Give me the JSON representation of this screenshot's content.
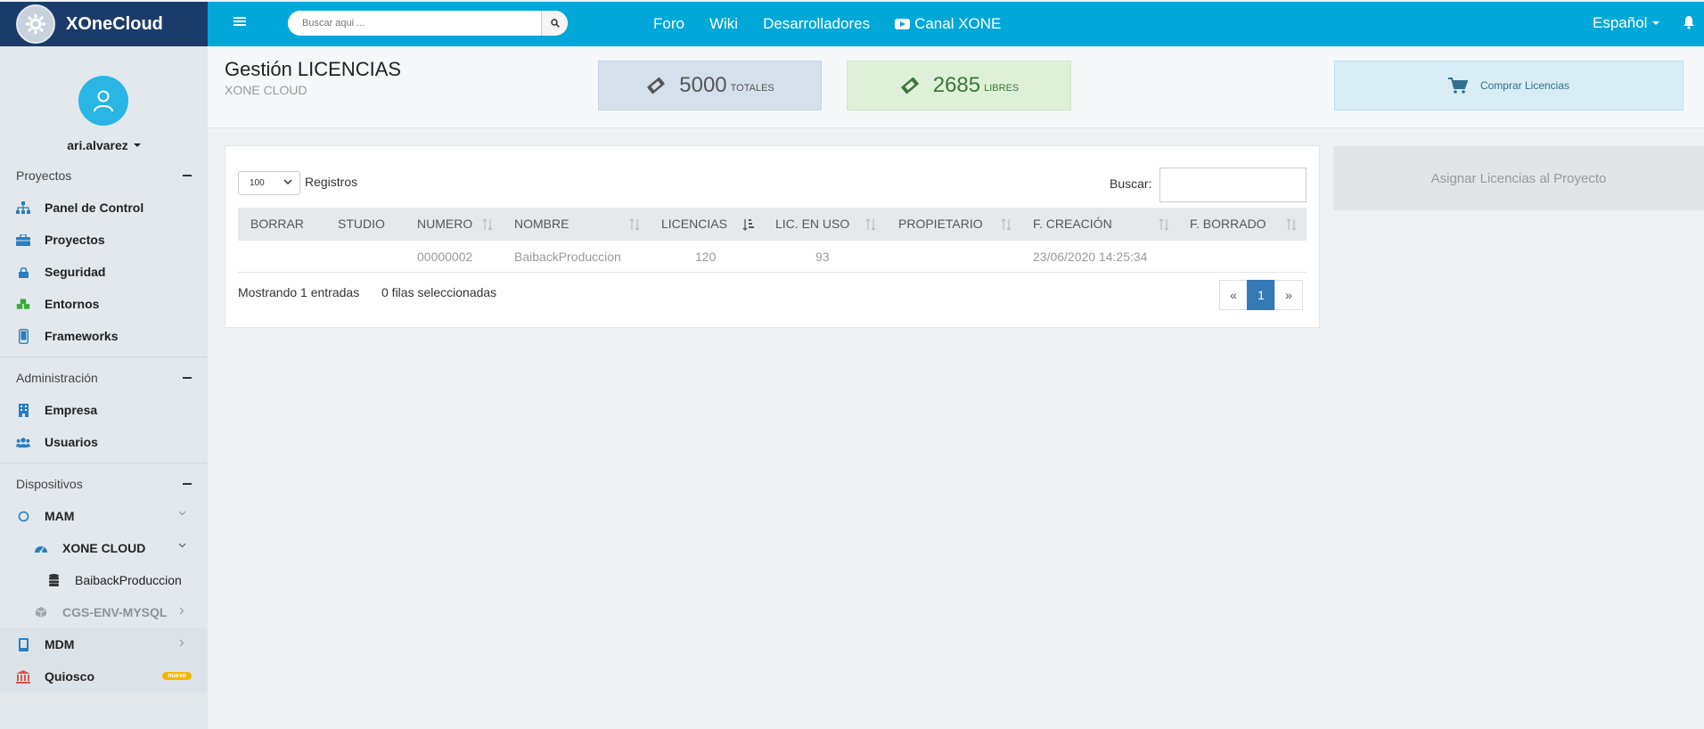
{
  "brand": {
    "name": "XOneCloud"
  },
  "search": {
    "placeholder": "Buscar aqui ..."
  },
  "topnav": {
    "items": [
      "Foro",
      "Wiki",
      "Desarrolladores",
      "Canal XONE"
    ]
  },
  "lang": {
    "label": "Español"
  },
  "user": {
    "name": "ari.alvarez"
  },
  "sidebar": {
    "sections": [
      {
        "title": "Proyectos",
        "items": [
          "Panel de Control",
          "Proyectos",
          "Seguridad",
          "Entornos",
          "Frameworks"
        ]
      },
      {
        "title": "Administración",
        "items": [
          "Empresa",
          "Usuarios"
        ]
      },
      {
        "title": "Dispositivos",
        "items": [
          "MAM",
          "XONE CLOUD",
          "BaibackProduccion",
          "CGS-ENV-MYSQL",
          "MDM",
          "Quiosco"
        ]
      }
    ],
    "badge": "nuevo"
  },
  "page": {
    "title": "Gestión LICENCIAS",
    "subtitle": "XONE CLOUD"
  },
  "stats": {
    "total": {
      "value": "5000",
      "label": "TOTALES"
    },
    "free": {
      "value": "2685",
      "label": "LIBRES"
    }
  },
  "buy": {
    "label": "Comprar Licencias"
  },
  "assign": {
    "label": "Asignar Licencias al Proyecto"
  },
  "table": {
    "length": "100",
    "length_label": "Registros",
    "search_label": "Buscar:",
    "columns": [
      "BORRAR",
      "STUDIO",
      "NUMERO",
      "NOMBRE",
      "LICENCIAS",
      "LIC. EN USO",
      "PROPIETARIO",
      "F. CREACIÓN",
      "F. BORRADO"
    ],
    "rows": [
      [
        "",
        "",
        "00000002",
        "BaibackProduccion",
        "120",
        "93",
        "",
        "23/06/2020 14:25:34",
        ""
      ]
    ],
    "info": "Mostrando 1 entradas",
    "selected": "0 filas seleccionadas"
  },
  "pager": {
    "prev": "«",
    "current": "1",
    "next": "»"
  },
  "colors": {
    "topbar": "#00a8da",
    "brand": "#1b3c6b",
    "accent": "#29b6e5",
    "pager_active": "#337ab7"
  }
}
